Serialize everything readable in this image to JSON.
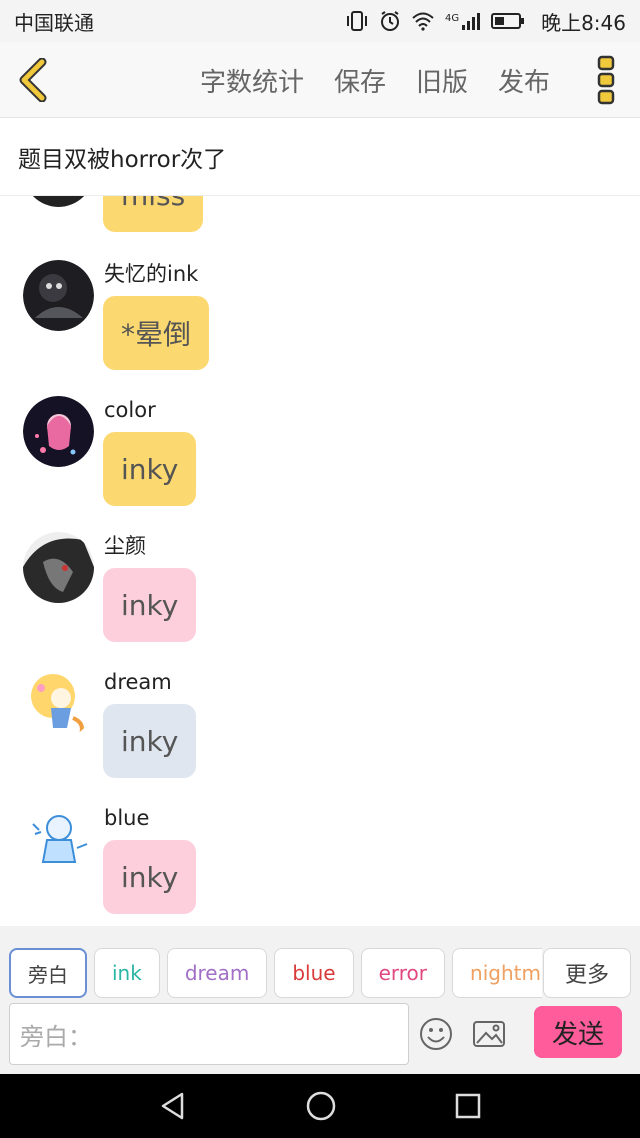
{
  "status_bar": {
    "carrier": "中国联通",
    "network": "4G",
    "time": "晚上8:46"
  },
  "top_bar": {
    "actions": [
      "字数统计",
      "保存",
      "旧版",
      "发布"
    ],
    "back_icon": "chevron-left-icon",
    "more_icon": "more-vertical-icon",
    "accent": "#f0c83c"
  },
  "title": "题目双被horror次了",
  "messages": [
    {
      "sender": "",
      "text": "miss",
      "bubble_color": "#fcd970",
      "partial": true
    },
    {
      "sender": "失忆的ink",
      "text": "*晕倒",
      "bubble_color": "#fcd970"
    },
    {
      "sender": "color",
      "text": "inky",
      "bubble_color": "#fcd970"
    },
    {
      "sender": "尘颜",
      "text": "inky",
      "bubble_color": "#fdcfdc"
    },
    {
      "sender": "dream",
      "text": "inky",
      "bubble_color": "#dfe6ef"
    },
    {
      "sender": "blue",
      "text": "inky",
      "bubble_color": "#fdcfdc"
    }
  ],
  "chips": [
    {
      "label": "旁白",
      "color": "#444444",
      "active": true
    },
    {
      "label": "ink",
      "color": "#2bb5a5",
      "active": false
    },
    {
      "label": "dream",
      "color": "#a26fc7",
      "active": false
    },
    {
      "label": "blue",
      "color": "#d93a3a",
      "active": false
    },
    {
      "label": "error",
      "color": "#e0497f",
      "active": false
    },
    {
      "label": "nightmare",
      "color": "#f0a060",
      "active": false
    }
  ],
  "more_chip": "更多",
  "input": {
    "placeholder": "旁白："
  },
  "send_label": "发送",
  "colors": {
    "send": "#ff5c9b",
    "chip_active_border": "#6a8fd4"
  }
}
